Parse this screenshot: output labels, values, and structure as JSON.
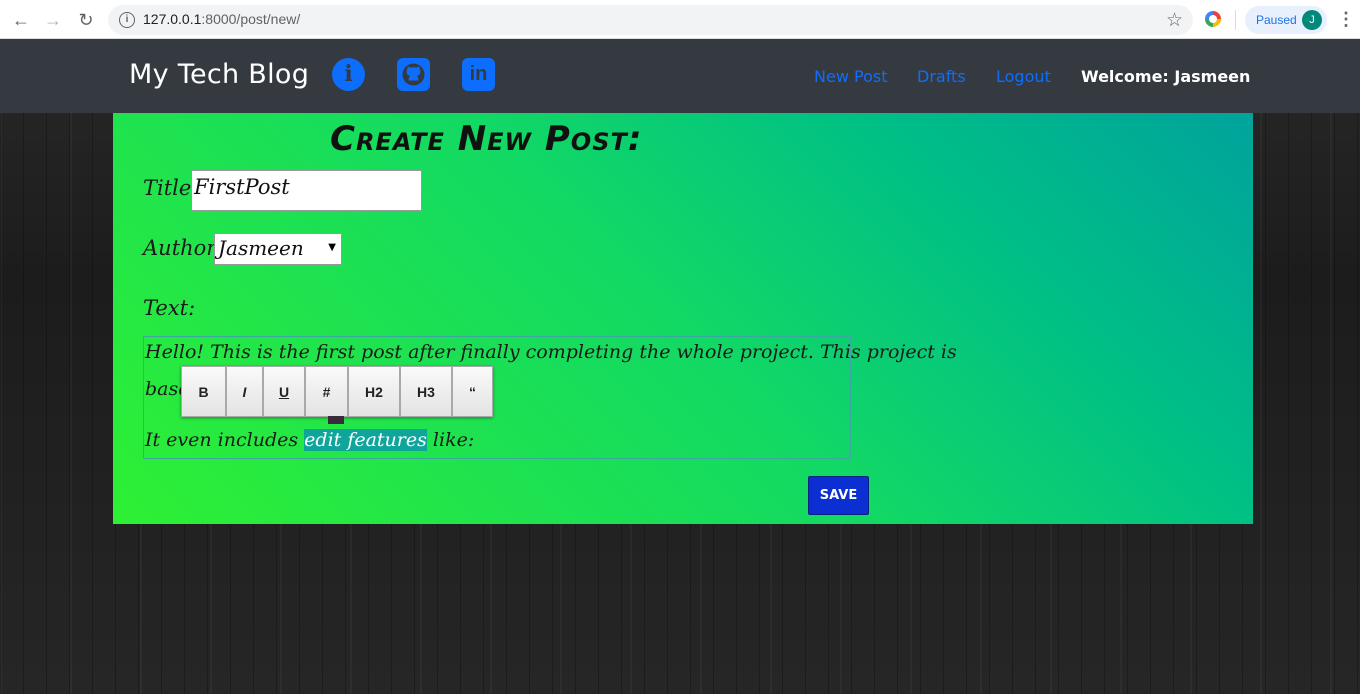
{
  "browser": {
    "url_host": "127.0.0.1",
    "url_rest": ":8000/post/new/",
    "profile_status": "Paused",
    "profile_initial": "J"
  },
  "site": {
    "brand": "My Tech Blog",
    "icons": [
      "info-icon",
      "github-icon",
      "linkedin-icon"
    ],
    "nav_links": [
      "New Post",
      "Drafts",
      "Logout"
    ],
    "welcome": "Welcome: Jasmeen",
    "colors": {
      "nav_bg": "#343a40",
      "link": "#0d6efd"
    }
  },
  "form": {
    "heading": "Create New Post:",
    "title_label": "Title:",
    "title_value": "FirstPost",
    "author_label": "Author:",
    "author_value": "Jasmeen",
    "text_label": "Text:",
    "text_line1": "Hello! This is the first post after finally completing the whole project. This project is",
    "text_line2_start": "basc",
    "text_line3_before": "It even includes ",
    "text_line3_highlight": "edit features",
    "text_line3_after": " like:",
    "toolbar": [
      "B",
      "I",
      "U",
      "#",
      "H2",
      "H3",
      "“"
    ],
    "save_label": "SAVE"
  }
}
